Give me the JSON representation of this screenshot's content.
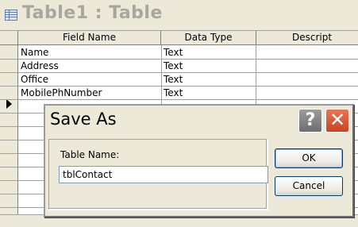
{
  "window": {
    "title": "Table1 : Table"
  },
  "grid": {
    "columns": [
      "Field Name",
      "Data Type",
      "Descript"
    ],
    "rows": [
      {
        "field": "Name",
        "type": "Text"
      },
      {
        "field": "Address",
        "type": "Text"
      },
      {
        "field": "Office",
        "type": "Text"
      },
      {
        "field": "MobilePhNumber",
        "type": "Text"
      }
    ]
  },
  "dialog": {
    "title": "Save As",
    "help_glyph": "?",
    "close_glyph": "✕",
    "field_label": "Table Name:",
    "field_value": "tblContact",
    "ok_label": "OK",
    "cancel_label": "Cancel"
  },
  "icons": {
    "title_icon": "table-design-icon",
    "row_selector": "current-row-pointer-icon",
    "help": "help-icon",
    "close": "close-icon"
  },
  "colors": {
    "close_button": "#c8431f",
    "help_button": "#7e7e7e",
    "input_border": "#7f9db9",
    "button_border": "#003c74"
  }
}
